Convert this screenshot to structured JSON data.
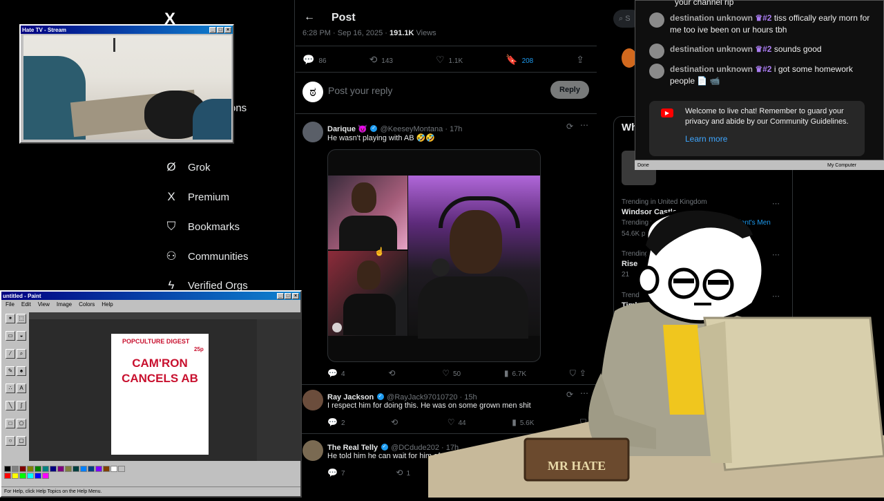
{
  "nav": {
    "logo": "X",
    "partial_label": "ons",
    "items": [
      {
        "icon": "Ø",
        "label": "Grok"
      },
      {
        "icon": "X",
        "label": "Premium"
      },
      {
        "icon": "⛉",
        "label": "Bookmarks"
      },
      {
        "icon": "⚇",
        "label": "Communities"
      },
      {
        "icon": "ϟ",
        "label": "Verified Orgs"
      }
    ]
  },
  "post": {
    "header_title": "Post",
    "time_date": "6:28 PM · Sep 16, 2025 · ",
    "views_count": "191.1K",
    "views_label": " Views",
    "stats": {
      "replies": "86",
      "reposts": "143",
      "likes": "1.1K",
      "bookmarks": "208"
    },
    "reply_placeholder": "Post your reply",
    "reply_button": "Reply"
  },
  "tweets": [
    {
      "name": "Darique 😈",
      "handle": "@KeeseyMontana · 17h",
      "text": "He wasn't playing with AB 🤣🤣",
      "replies": "4",
      "reposts": "",
      "likes": "50",
      "views": "6.7K"
    },
    {
      "name": "Ray Jackson",
      "handle": "@RayJack97010720 · 15h",
      "text": "I respect him for doing this. He was on some grown men shit",
      "replies": "2",
      "reposts": "",
      "likes": "44",
      "views": "5.6K"
    },
    {
      "name": "The Real Telly",
      "handle": "@DCdude202 · 17h",
      "text": "He told him he can wait for him af",
      "replies": "7",
      "reposts": "1",
      "likes": "",
      "views": ""
    }
  ],
  "trends": {
    "heading": "Wh",
    "items": [
      {
        "context": "Trending in United Kingdom",
        "title": "Windsor Castle",
        "sub": "Trending wi",
        "sub_link": "sident's Men",
        "posts": "54.6K po"
      },
      {
        "context": "Trending",
        "title": "Rise",
        "posts": "21"
      },
      {
        "context": "Trend",
        "title": "Timb"
      }
    ]
  },
  "search_placeholder": "S",
  "chat": {
    "partial_top": "your channel rip",
    "messages": [
      {
        "name": "destination unknown",
        "badge": "#2",
        "text": "tiss offically early morn for me too ive been on ur hours tbh"
      },
      {
        "name": "destination unknown",
        "badge": "#2",
        "text": "sounds good"
      },
      {
        "name": "destination unknown",
        "badge": "#2",
        "text": "i got some homework people 📄 📹"
      }
    ],
    "welcome_text": "Welcome to live chat! Remember to guard your privacy and abide by our Community Guidelines.",
    "learn_more": "Learn more",
    "status_left": "Done",
    "status_right": "My Computer"
  },
  "tv_window": {
    "title": "Hate TV - Stream"
  },
  "paint_window": {
    "title": "untitled - Paint",
    "menus": [
      "File",
      "Edit",
      "View",
      "Image",
      "Colors",
      "Help"
    ],
    "doc_brand": "POPCULTURE DIGEST",
    "doc_price": "25p",
    "doc_headline": "CAM'RON CANCELS AB",
    "status": "For Help, click Help Topics on the Help Menu."
  },
  "mascot": {
    "plaque": "MR HATE"
  },
  "colors": {
    "x_blue": "#1d9bf0",
    "chat_badge": "#a97cf0",
    "headline_red": "#c8102e",
    "win_title": "#000080"
  }
}
